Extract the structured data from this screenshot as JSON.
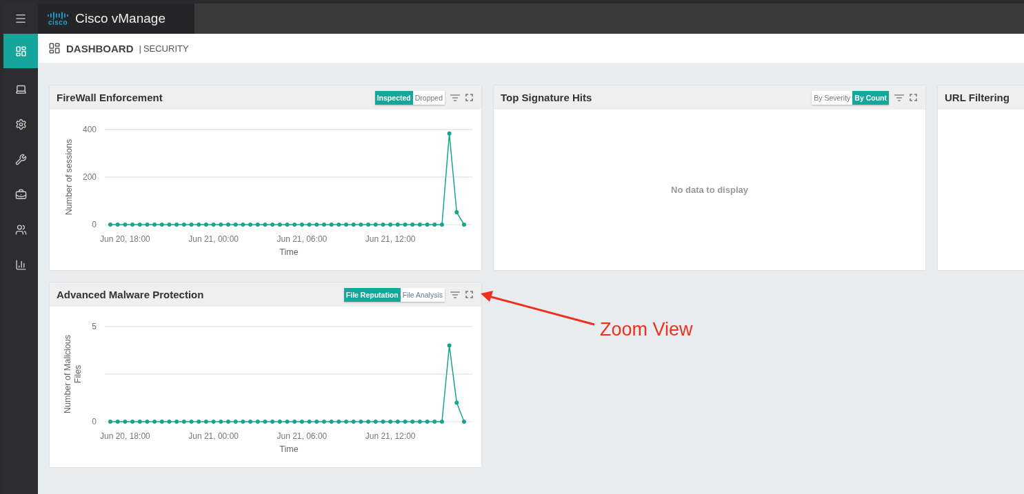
{
  "topbar": {
    "logo_text": "cisco",
    "app_title": "Cisco vManage"
  },
  "sidebar": {
    "items": [
      {
        "kind": "dashboard",
        "selected": true
      },
      {
        "kind": "monitor",
        "selected": false
      },
      {
        "kind": "configuration",
        "selected": false
      },
      {
        "kind": "tools",
        "selected": false
      },
      {
        "kind": "maintenance",
        "selected": false
      },
      {
        "kind": "administration",
        "selected": false
      },
      {
        "kind": "analytics",
        "selected": false
      }
    ]
  },
  "header": {
    "title": "DASHBOARD",
    "separator": "|",
    "subtitle": "SECURITY"
  },
  "cards": [
    {
      "title": "FireWall Enforcement",
      "toggles": [
        {
          "label": "Inspected",
          "selected": true
        },
        {
          "label": "Dropped",
          "selected": false
        }
      ],
      "chart_data": {
        "type": "line",
        "xlabel": "Time",
        "ylabel": "Number of sessions",
        "categories": [
          null,
          null,
          "Jun 20, 18:00",
          null,
          null,
          null,
          null,
          null,
          null,
          null,
          null,
          null,
          null,
          null,
          "Jun 21, 00:00",
          null,
          null,
          null,
          null,
          null,
          null,
          null,
          null,
          null,
          null,
          null,
          "Jun 21, 06:00",
          null,
          null,
          null,
          null,
          null,
          null,
          null,
          null,
          null,
          null,
          null,
          "Jun 21, 12:00",
          null,
          null,
          null,
          null,
          null,
          null,
          null,
          null,
          null,
          null
        ],
        "series": [
          {
            "color": "#16a58e",
            "marker": "circle",
            "values": [
              0,
              0,
              0,
              0,
              0,
              0,
              0,
              0,
              0,
              0,
              0,
              0,
              0,
              0,
              0,
              0,
              0,
              0,
              0,
              0,
              0,
              0,
              0,
              0,
              0,
              0,
              0,
              0,
              0,
              0,
              0,
              0,
              0,
              0,
              0,
              0,
              0,
              0,
              0,
              0,
              0,
              0,
              0,
              0,
              0,
              0,
              383,
              52,
              0
            ]
          }
        ],
        "ylim": [
          0,
          400
        ],
        "yticks": [
          0,
          200,
          400
        ]
      }
    },
    {
      "title": "Top Signature Hits",
      "toggles": [
        {
          "label": "By Severity",
          "selected": false
        },
        {
          "label": "By Count",
          "selected": true
        }
      ],
      "empty_text": "No data to display"
    },
    {
      "title": "URL Filtering"
    },
    {
      "title": "Advanced Malware Protection",
      "toggles": [
        {
          "label": "File Reputation",
          "selected": true
        },
        {
          "label": "File Analysis",
          "selected": false
        }
      ],
      "chart_data": {
        "type": "line",
        "xlabel": "Time",
        "ylabel": "Number of Malicious Files",
        "categories": [
          null,
          null,
          "Jun 20, 18:00",
          null,
          null,
          null,
          null,
          null,
          null,
          null,
          null,
          null,
          null,
          null,
          "Jun 21, 00:00",
          null,
          null,
          null,
          null,
          null,
          null,
          null,
          null,
          null,
          null,
          null,
          "Jun 21, 06:00",
          null,
          null,
          null,
          null,
          null,
          null,
          null,
          null,
          null,
          null,
          null,
          "Jun 21, 12:00",
          null,
          null,
          null,
          null,
          null,
          null,
          null,
          null,
          null,
          null
        ],
        "series": [
          {
            "color": "#16a58e",
            "marker": "circle",
            "values": [
              0,
              0,
              0,
              0,
              0,
              0,
              0,
              0,
              0,
              0,
              0,
              0,
              0,
              0,
              0,
              0,
              0,
              0,
              0,
              0,
              0,
              0,
              0,
              0,
              0,
              0,
              0,
              0,
              0,
              0,
              0,
              0,
              0,
              0,
              0,
              0,
              0,
              0,
              0,
              0,
              0,
              0,
              0,
              0,
              0,
              0,
              4,
              1,
              0
            ]
          }
        ],
        "ylim": [
          0,
          5
        ],
        "yticks": [
          0,
          {
            "value": 2.5,
            "label": null
          },
          5
        ]
      }
    }
  ],
  "annotation": {
    "text": "Zoom View"
  }
}
